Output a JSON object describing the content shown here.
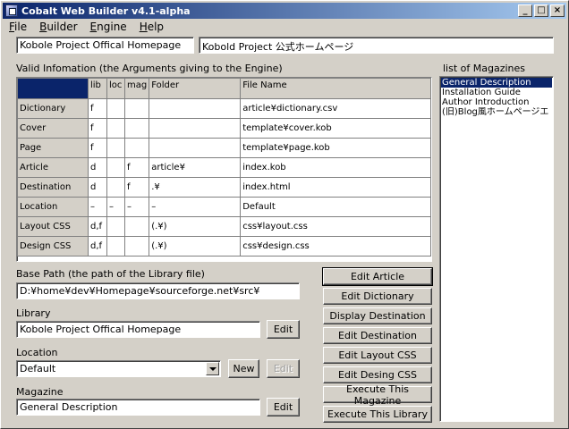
{
  "window": {
    "title": "Cobalt Web Builder v4.1-alpha",
    "buttons": {
      "minimize": "_",
      "maximize": "□",
      "close": "×"
    }
  },
  "menu": {
    "file": {
      "hot": "F",
      "rest": "ile"
    },
    "builder": {
      "hot": "B",
      "rest": "uilder"
    },
    "engine": {
      "hot": "E",
      "rest": "ngine"
    },
    "help": {
      "hot": "H",
      "rest": "elp"
    }
  },
  "header": {
    "project_name": "Kobole Project Offical Homepage",
    "project_name_jp": "Kobold Project 公式ホームページ"
  },
  "valid_info": {
    "label": "Valid Infomation (the Arguments giving to the Engine)",
    "columns": [
      "",
      "lib",
      "loc",
      "mag",
      "Folder",
      "File Name"
    ],
    "rows": [
      {
        "name": "Dictionary",
        "lib": "f",
        "loc": "",
        "mag": "",
        "folder": "",
        "file": "article¥dictionary.csv"
      },
      {
        "name": "Cover",
        "lib": "f",
        "loc": "",
        "mag": "",
        "folder": "",
        "file": "template¥cover.kob"
      },
      {
        "name": "Page",
        "lib": "f",
        "loc": "",
        "mag": "",
        "folder": "",
        "file": "template¥page.kob"
      },
      {
        "name": "Article",
        "lib": "d",
        "loc": "",
        "mag": "f",
        "folder": "article¥",
        "file": "index.kob"
      },
      {
        "name": "Destination",
        "lib": "d",
        "loc": "",
        "mag": "f",
        "folder": ".¥",
        "file": "index.html"
      },
      {
        "name": "Location",
        "lib": "–",
        "loc": "–",
        "mag": "–",
        "folder": "–",
        "file": "Default"
      },
      {
        "name": "Layout CSS",
        "lib": "d,f",
        "loc": "",
        "mag": "",
        "folder": "(.¥)",
        "file": "css¥layout.css"
      },
      {
        "name": "Design CSS",
        "lib": "d,f",
        "loc": "",
        "mag": "",
        "folder": "(.¥)",
        "file": "css¥design.css"
      }
    ]
  },
  "base_path": {
    "label": "Base Path (the path of the Library file)",
    "value": "D:¥home¥dev¥Homepage¥sourceforge.net¥src¥"
  },
  "library": {
    "label": "Library",
    "value": "Kobole Project Offical Homepage",
    "edit": "Edit"
  },
  "location": {
    "label": "Location",
    "value": "Default",
    "new": "New",
    "edit": "Edit"
  },
  "magazine": {
    "label": "Magazine",
    "value": "General Description",
    "edit": "Edit"
  },
  "actions": [
    "Edit Article",
    "Edit Dictionary",
    "Display Destination",
    "Edit Destination",
    "Edit Layout CSS",
    "Edit Desing CSS",
    "Execute This Magazine",
    "Execute This Library"
  ],
  "magazines": {
    "label": "list of Magazines",
    "items": [
      "General Description",
      "Installation Guide",
      "Author Introduction",
      "(旧)Blog風ホームページエ"
    ],
    "selected_index": 0
  },
  "colors": {
    "face": "#d4d0c8",
    "title_active": "#0a246a",
    "selection": "#0a246a"
  }
}
